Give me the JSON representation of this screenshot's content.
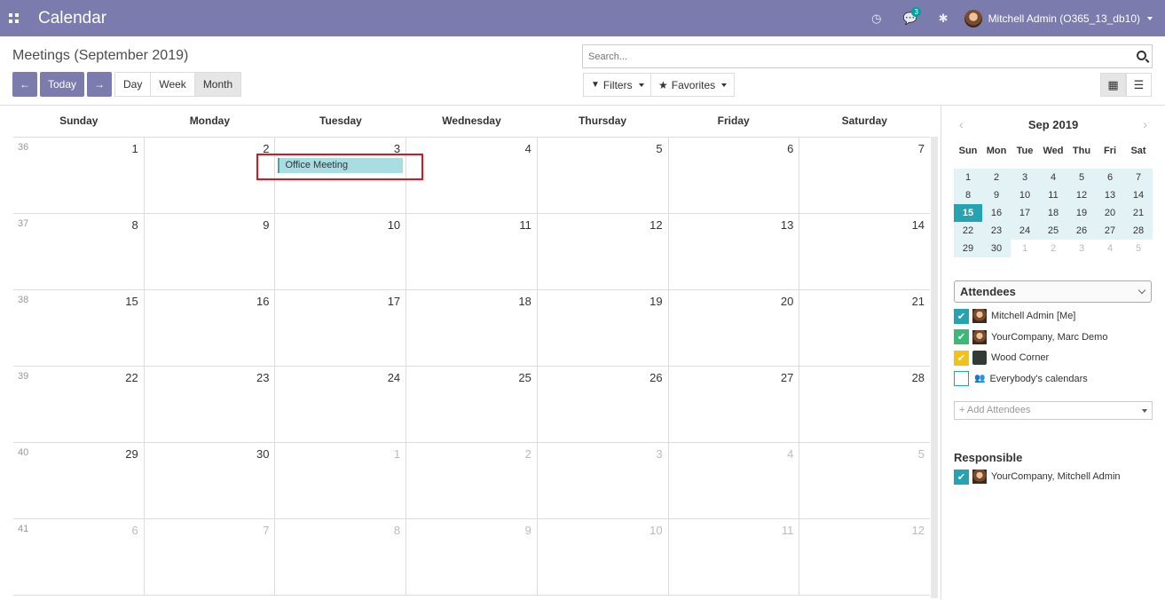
{
  "topbar": {
    "app_title": "Calendar",
    "messages_count": "3",
    "user_name": "Mitchell Admin (O365_13_db10)",
    "icons": [
      "apps-icon",
      "clock-icon",
      "chat-icon",
      "bug-icon"
    ]
  },
  "control": {
    "breadcrumb": "Meetings (September 2019)",
    "prev_label": "←",
    "today_label": "Today",
    "next_label": "→",
    "scales": [
      "Day",
      "Week",
      "Month"
    ],
    "active_scale": "Month",
    "search_placeholder": "Search...",
    "filters_label": "Filters",
    "favorites_label": "Favorites"
  },
  "calendar": {
    "weekdays": [
      "Sunday",
      "Monday",
      "Tuesday",
      "Wednesday",
      "Thursday",
      "Friday",
      "Saturday"
    ],
    "weeks": [
      {
        "num": "36",
        "days": [
          "1",
          "2",
          "3",
          "4",
          "5",
          "6",
          "7"
        ],
        "other": []
      },
      {
        "num": "37",
        "days": [
          "8",
          "9",
          "10",
          "11",
          "12",
          "13",
          "14"
        ],
        "other": []
      },
      {
        "num": "38",
        "days": [
          "15",
          "16",
          "17",
          "18",
          "19",
          "20",
          "21"
        ],
        "other": []
      },
      {
        "num": "39",
        "days": [
          "22",
          "23",
          "24",
          "25",
          "26",
          "27",
          "28"
        ],
        "other": []
      },
      {
        "num": "40",
        "days": [
          "29",
          "30",
          "1",
          "2",
          "3",
          "4",
          "5"
        ],
        "other": [
          2,
          3,
          4,
          5,
          6
        ]
      },
      {
        "num": "41",
        "days": [
          "6",
          "7",
          "8",
          "9",
          "10",
          "11",
          "12"
        ],
        "other": [
          0,
          1,
          2,
          3,
          4,
          5,
          6
        ]
      }
    ],
    "event": {
      "title": "Office Meeting",
      "week": 0,
      "day": 2,
      "color": "#a8dde2"
    }
  },
  "mini_calendar": {
    "title": "Sep 2019",
    "prev": "‹",
    "next": "›",
    "weekdays": [
      "Sun",
      "Mon",
      "Tue",
      "Wed",
      "Thu",
      "Fri",
      "Sat"
    ],
    "rows": [
      [
        "1",
        "2",
        "3",
        "4",
        "5",
        "6",
        "7"
      ],
      [
        "8",
        "9",
        "10",
        "11",
        "12",
        "13",
        "14"
      ],
      [
        "15",
        "16",
        "17",
        "18",
        "19",
        "20",
        "21"
      ],
      [
        "22",
        "23",
        "24",
        "25",
        "26",
        "27",
        "28"
      ],
      [
        "29",
        "30",
        "1",
        "2",
        "3",
        "4",
        "5"
      ]
    ],
    "today": "15"
  },
  "sidebar": {
    "attendees_title": "Attendees",
    "attendees": [
      {
        "label": "Mitchell Admin [Me]",
        "color": "#26a3b1",
        "checked": true
      },
      {
        "label": "YourCompany, Marc Demo",
        "color": "#3ab97a",
        "checked": true
      },
      {
        "label": "Wood Corner",
        "color": "#f2c21b",
        "checked": true
      },
      {
        "label": "Everybody's calendars",
        "color": "",
        "checked": false
      }
    ],
    "add_attendees_placeholder": "+ Add Attendees",
    "responsible_title": "Responsible",
    "responsible": [
      {
        "label": "YourCompany, Mitchell Admin",
        "color": "#26a3b1",
        "checked": true
      }
    ]
  }
}
